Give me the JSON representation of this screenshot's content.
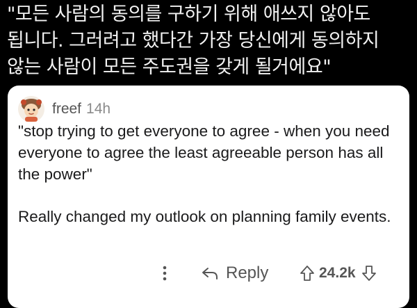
{
  "caption": {
    "lines": [
      "\"모든 사람의 동의를 구하기 위해 애쓰지 않아도",
      "됩니다. 그러려고 했다간 가장 당신에게 동의하지",
      "않는 사람이 모든 주도권을 갖게 될거에요\""
    ]
  },
  "comment": {
    "username": "freef",
    "timestamp": "14h",
    "quote": "\"stop trying to get everyone to agree - when you need everyone to agree the least agreeable person has all the power\"",
    "body": "Really changed my outlook on planning family events.",
    "actions": {
      "reply_label": "Reply",
      "score": "24.2k"
    },
    "icons": {
      "avatar": "avatar-icon",
      "more": "more-options-icon",
      "reply": "reply-arrow-icon",
      "upvote": "upvote-arrow-icon",
      "downvote": "downvote-arrow-icon"
    }
  },
  "colors": {
    "background": "#000000",
    "caption_text": "#f2f2f2",
    "card": "#ffffff",
    "body_text": "#1a1a1b",
    "muted_text": "#555555",
    "timestamp_text": "#8a8a8a"
  }
}
